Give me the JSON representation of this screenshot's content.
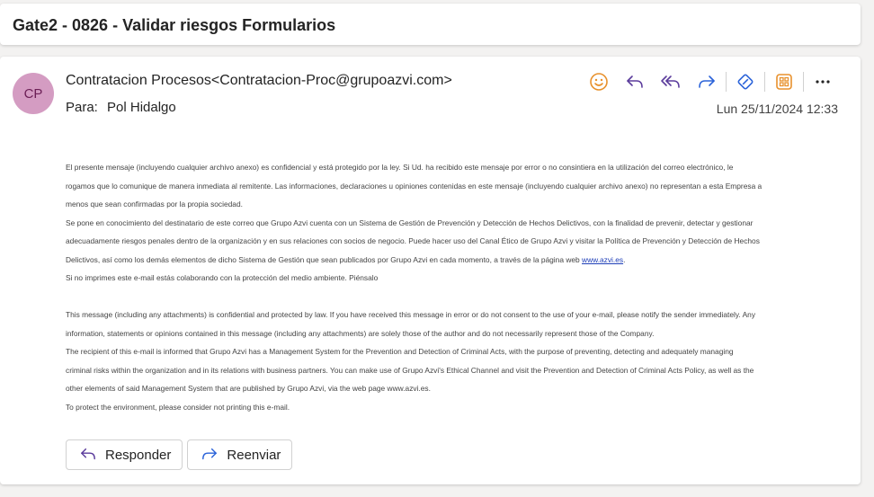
{
  "subject": "Gate2 - 0826 - Validar riesgos Formularios",
  "message": {
    "avatar_initials": "CP",
    "from": "Contratacion Procesos<Contratacion-Proc@grupoazvi.com>",
    "to_label": "Para:",
    "to": "Pol Hidalgo",
    "date": "Lun 25/11/2024 12:33"
  },
  "toolbar": {
    "icons": [
      "smiley-icon",
      "reply-icon",
      "reply-all-icon",
      "forward-icon",
      "loop-icon",
      "apps-icon",
      "more-icon"
    ]
  },
  "body": {
    "lines": [
      "El presente mensaje (incluyendo cualquier archivo anexo) es confidencial y está protegido por la ley. Si Ud. ha recibido este mensaje por error o no consintiera en la utilización del correo electrónico, le",
      "rogamos que lo comunique de manera inmediata al remitente. Las informaciones, declaraciones u opiniones contenidas en este mensaje (incluyendo cualquier archivo anexo) no representan a esta Empresa a",
      "menos que sean confirmadas por la propia sociedad.",
      "Se pone en conocimiento del destinatario de este correo que Grupo Azvi cuenta con un Sistema de Gestión de Prevención y Detección de Hechos Delictivos, con la finalidad de prevenir, detectar y gestionar",
      "adecuadamente riesgos penales dentro de la organización y en sus relaciones con socios de negocio. Puede hacer uso del Canal Ético de Grupo Azvi y visitar la Política de Prevención y Detección de Hechos"
    ],
    "line6_prefix": "Delictivos, así como los demás elementos de dicho Sistema de Gestión que sean publicados por Grupo Azvi en cada momento, a través de la página web ",
    "link_text": "www.azvi.es",
    "line6_suffix": ".",
    "line7": " Si no imprimes este e-mail estás colaborando con la protección del medio ambiente. Piénsalo",
    "en_lines": [
      "This message (including any attachments) is confidential and protected by law. If you have received this message in error or do not consent to the use of your e-mail, please notify the sender immediately. Any",
      "information, statements or opinions contained in this message (including any attachments) are solely those of the author and do not necessarily represent those of the Company.",
      "The recipient of this e-mail is informed that Grupo Azvi has a Management System for the Prevention and Detection of Criminal Acts, with the purpose of preventing, detecting and adequately managing",
      "criminal risks within the organization and in its relations with business partners. You can make use of Grupo Azvi's Ethical Channel and visit the Prevention and Detection of Criminal Acts Policy, as well as the",
      "other elements of said Management System that are published by Grupo Azvi, via the web page www.azvi.es.",
      "To protect the environment, please consider not printing this e-mail."
    ]
  },
  "buttons": {
    "reply": "Responder",
    "forward": "Reenviar"
  },
  "colors": {
    "avatar_bg": "#d49cc2",
    "smiley": "#e8912d",
    "action_purple": "#5b3c9c",
    "loop_blue": "#2b63d9",
    "apps_orange": "#e8912d"
  }
}
